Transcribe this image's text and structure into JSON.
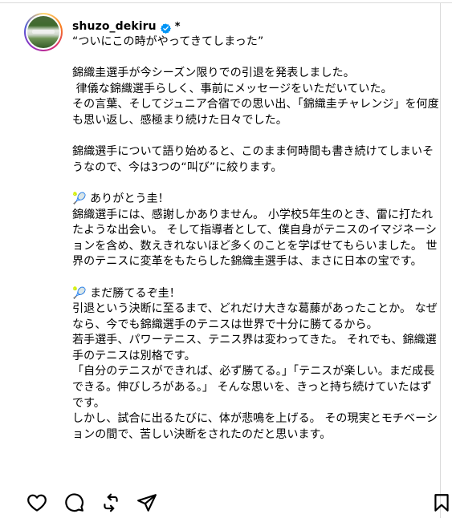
{
  "post": {
    "username": "shuzo_dekiru",
    "badge_suffix": "*",
    "caption": "“ついにこの時がやってきてしまった”\n\n錦織圭選手が今シーズン限りでの引退を発表しました。\n 律儀な錦織選手らしく、事前にメッセージをいただいていた。\nその言葉、そしてジュニア合宿での思い出、「錦織圭チャレンジ」を何度も思い返し、感極まり続けた日々でした。\n\n錦織選手について語り始めると、このまま何時間も書き続けてしまいそうなので、今は3つの“叫び”に絞ります。\n\n🎾 ありがとう圭！\n錦織選手には、感謝しかありません。 小学校5年生のとき、雷に打たれたような出会い。 そして指導者として、僕自身がテニスのイマジネーションを含め、数えきれないほど多くのことを学ばせてもらいました。 世界のテニスに変革をもたらした錦織圭選手は、まさに日本の宝です。\n\n🎾 まだ勝てるぞ圭！\n引退という決断に至るまで、どれだけ大きな葛藤があったことか。 なぜなら、今でも錦織選手のテニスは世界で十分に勝てるから。\n若手選手、パワーテニス、テニス界は変わってきた。 それでも、錦織選手のテニスは別格です。\n「自分のテニスができれば、必ず勝てる。」「テニスが楽しい。まだ成長できる。伸びしろがある。」 そんな思いを、きっと持ち続けていたはずです。\nしかし、試合に出るたびに、体が悲鳴を上げる。 その現実とモチベーションの間で、苦しい決断をされたのだと思います。"
  },
  "icons": {
    "verified": "verified-badge-icon",
    "like": "heart-icon",
    "comment": "comment-icon",
    "share": "repost-icon",
    "send": "send-icon",
    "save": "bookmark-icon"
  },
  "colors": {
    "verified": "#0095f6",
    "text": "#000000",
    "divider": "#dbdbdb"
  }
}
